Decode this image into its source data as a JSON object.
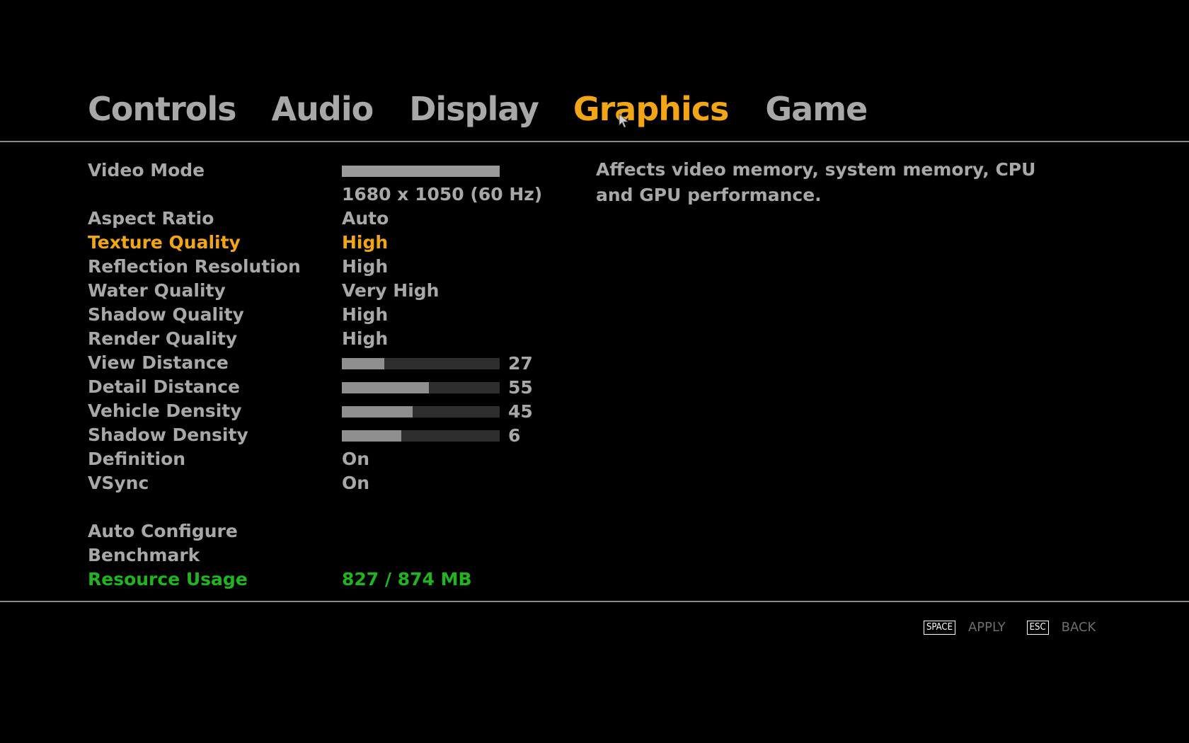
{
  "tabs": [
    {
      "label": "Controls",
      "active": false
    },
    {
      "label": "Audio",
      "active": false
    },
    {
      "label": "Display",
      "active": false
    },
    {
      "label": "Graphics",
      "active": true
    },
    {
      "label": "Game",
      "active": false
    }
  ],
  "settings": {
    "video_mode": {
      "label": "Video Mode",
      "value": "1680 x 1050 (60 Hz)"
    },
    "aspect_ratio": {
      "label": "Aspect Ratio",
      "value": "Auto"
    },
    "texture_quality": {
      "label": "Texture Quality",
      "value": "High"
    },
    "reflection_resolution": {
      "label": "Reflection Resolution",
      "value": "High"
    },
    "water_quality": {
      "label": "Water Quality",
      "value": "Very High"
    },
    "shadow_quality": {
      "label": "Shadow Quality",
      "value": "High"
    },
    "render_quality": {
      "label": "Render Quality",
      "value": "High"
    },
    "view_distance": {
      "label": "View Distance",
      "value": "27",
      "level": 0.27
    },
    "detail_distance": {
      "label": "Detail Distance",
      "value": "55",
      "level": 0.55
    },
    "vehicle_density": {
      "label": "Vehicle Density",
      "value": "45",
      "level": 0.45
    },
    "shadow_density": {
      "label": "Shadow Density",
      "value": "6",
      "level": 0.375
    },
    "definition": {
      "label": "Definition",
      "value": "On"
    },
    "vsync": {
      "label": "VSync",
      "value": "On"
    },
    "auto_configure": {
      "label": "Auto Configure"
    },
    "benchmark": {
      "label": "Benchmark"
    },
    "resource_usage": {
      "label": "Resource Usage",
      "value": "827 / 874 MB"
    }
  },
  "description": "Affects video memory, system memory, CPU and GPU performance.",
  "footer": {
    "apply_key": "SPACE",
    "apply_label": "APPLY",
    "back_key": "ESC",
    "back_label": "BACK"
  },
  "colors": {
    "active": "#f2a516",
    "default": "#a8a8a8",
    "resource": "#1fb51f",
    "background": "#000000"
  }
}
